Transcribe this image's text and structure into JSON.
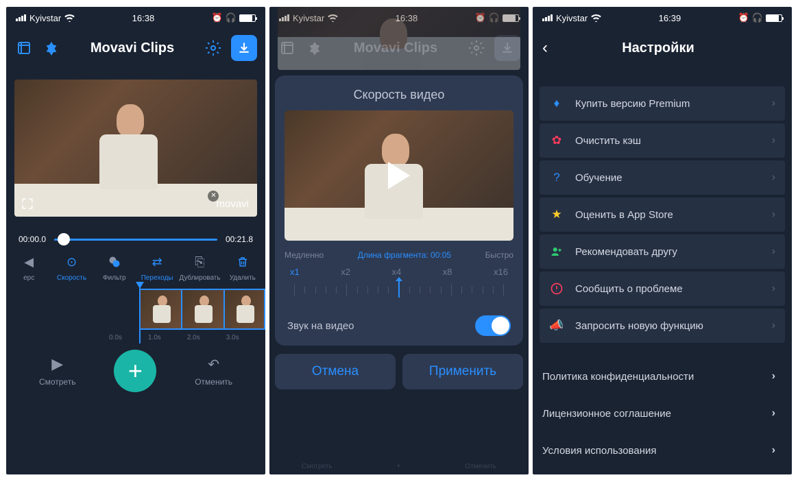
{
  "status": {
    "carrier": "Kyivstar",
    "time1": "16:38",
    "time2": "16:38",
    "time3": "16:39"
  },
  "s1": {
    "title": "Movavi Clips",
    "watermark": "movavi",
    "t_start": "00:00.0",
    "t_end": "00:21.8",
    "tools": [
      "ерс",
      "Скорость",
      "Фильтр",
      "Переходы",
      "Дублировать",
      "Удалить"
    ],
    "ruler": [
      "0.0s",
      "1.0s",
      "2.0s",
      "3.0s"
    ],
    "watch": "Смотреть",
    "undo": "Отменить"
  },
  "s2": {
    "title": "Movavi Clips",
    "modal_title": "Скорость видео",
    "slow": "Медленно",
    "frag": "Длина фрагмента: 00:05",
    "fast": "Быстро",
    "ticks": [
      "x1",
      "x2",
      "x4",
      "x8",
      "x16"
    ],
    "sound": "Звук на видео",
    "cancel": "Отмена",
    "apply": "Применить",
    "dim": [
      "Смотреть",
      "Отменить"
    ]
  },
  "s3": {
    "title": "Настройки",
    "items": [
      {
        "icon": "diamond",
        "label": "Купить версию Premium"
      },
      {
        "icon": "heart",
        "label": "Очистить кэш"
      },
      {
        "icon": "quest",
        "label": "Обучение"
      },
      {
        "icon": "star",
        "label": "Оценить в App Store"
      },
      {
        "icon": "friend",
        "label": "Рекомендовать другу"
      },
      {
        "icon": "alert",
        "label": "Сообщить о проблеме"
      },
      {
        "icon": "mega",
        "label": "Запросить новую функцию"
      }
    ],
    "plain": [
      "Политика конфиденциальности",
      "Лицензионное соглашение",
      "Условия использования"
    ]
  }
}
